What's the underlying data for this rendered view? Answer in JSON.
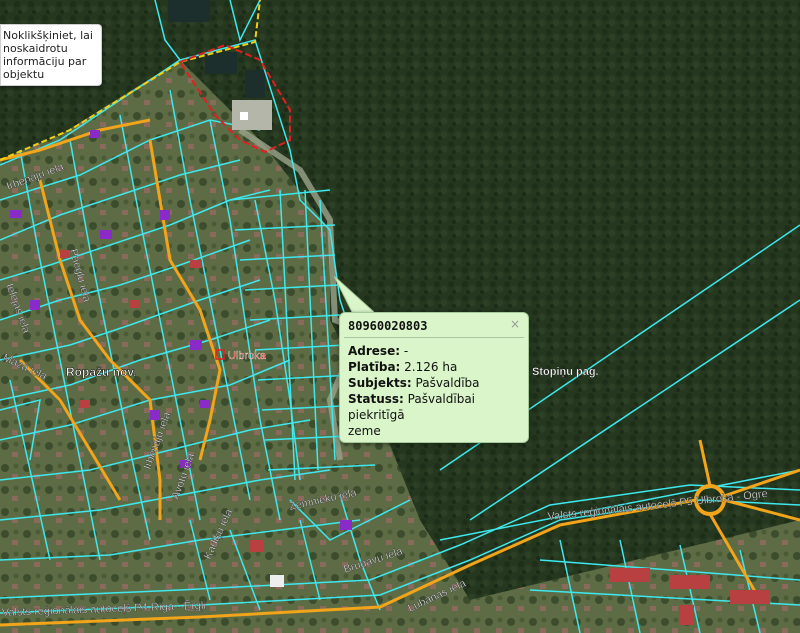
{
  "hint": {
    "lines": [
      "Noklikšķiniet, lai",
      "noskaidrotu",
      "informāciju par",
      "objektu"
    ]
  },
  "popup": {
    "title": "80960020803",
    "close": "×",
    "fields": [
      {
        "label": "Adrese:",
        "value": "-"
      },
      {
        "label": "Platība:",
        "value": "2.126 ha"
      },
      {
        "label": "Subjekts:",
        "value": "Pašvaldība"
      },
      {
        "label": "Statuss:",
        "value": "Pašvaldībai piekritīgā"
      },
      {
        "label": "",
        "value": "zeme"
      }
    ]
  },
  "labels": {
    "irbenaju_top": "Irbenāju iela",
    "paeglu": "Paegļu iela",
    "ielejas": "Ielejas iela",
    "mazas": "Mazā iela",
    "ropazu": "Ropažu nov.",
    "ulbroka": "Ulbroka",
    "stopinu": "Stopiņu pag.",
    "irbenaju_bottom": "Irbenāju iela",
    "avotu": "Avotu iela",
    "kadiku": "Kadiķu iela",
    "zemnieku": "Zemnieku iela",
    "brunavu": "Brunavu iela",
    "lubanas": "Lubānas iela",
    "p5": "Valsts reģionālais autoceļš P5 Ulbroka - Ogre",
    "p4": "Valsts reģionālais autoceļš P4 Rīga - Ērgļi"
  },
  "colors": {
    "parcel": "#3ee8ee",
    "road": "#f2a41a",
    "boundary_red": "#e0201e",
    "boundary_yellow": "#f0d016",
    "building": "#8a2ac8",
    "forest": "#24361f",
    "settlement": "#5a6b42"
  }
}
